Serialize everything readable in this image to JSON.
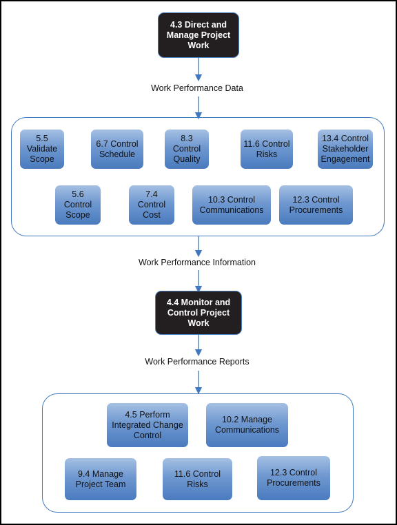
{
  "nodes": {
    "direct_manage": "4.3 Direct and Manage Project Work",
    "monitor_control": "4.4 Monitor and Control Project Work"
  },
  "flows": {
    "work_performance_data": "Work Performance Data",
    "work_performance_information": "Work Performance Information",
    "work_performance_reports": "Work Performance Reports"
  },
  "control_processes": [
    "5.5 Validate Scope",
    "6.7 Control Schedule",
    "8.3 Control Quality",
    "11.6 Control Risks",
    "13.4 Control Stakeholder Engagement",
    "5.6 Control Scope",
    "7.4 Control Cost",
    "10.3 Control Communications",
    "12.3 Control Procurements"
  ],
  "report_recipients": [
    "4.5 Perform Integrated Change Control",
    "10.2 Manage Communications",
    "9.4 Manage Project Team",
    "11.6 Control Risks",
    "12.3 Control Procurements"
  ],
  "colors": {
    "accent_blue": "#3f78c0",
    "node_dark": "#231f20"
  }
}
